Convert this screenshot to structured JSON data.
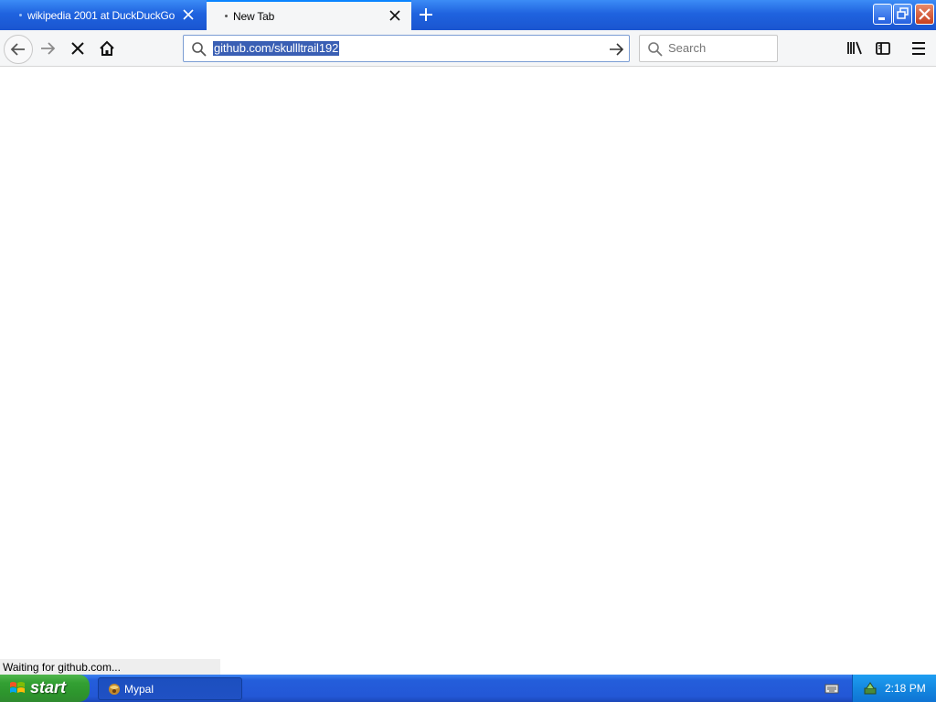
{
  "browser": {
    "tabs": [
      {
        "title": "wikipedia 2001 at DuckDuckGo",
        "active": false
      },
      {
        "title": "New Tab",
        "active": true
      }
    ],
    "url": "github.com/skullltrail192",
    "search_placeholder": "Search",
    "status": "Waiting for github.com..."
  },
  "taskbar": {
    "start_label": "start",
    "tasks": [
      {
        "label": "Mypal"
      }
    ],
    "clock": "2:18 PM"
  },
  "colors": {
    "accent": "#0a84ff",
    "url_selection": "#3a5fb4",
    "taskbar_blue": "#245edb",
    "start_green": "#33a033"
  }
}
